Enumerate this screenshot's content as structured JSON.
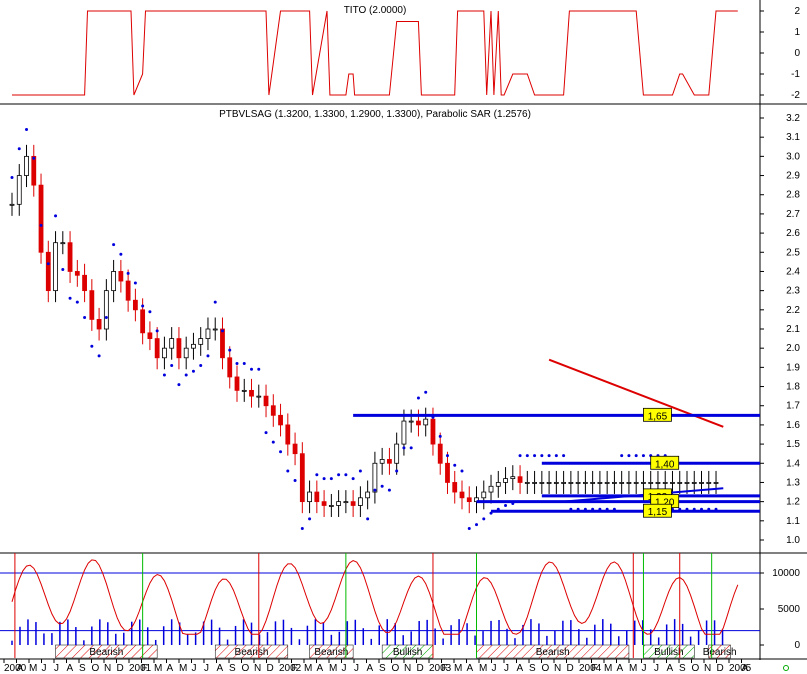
{
  "colors": {
    "red": "#dd0000",
    "blue": "#0000dd",
    "green": "#00bb00",
    "lvlbox": "#ffff00",
    "hatch": "#dd0000"
  },
  "chart_data": [
    {
      "type": "line",
      "title": "TITO (2.0000)",
      "ylim": [
        -2,
        2
      ],
      "ticks": [
        "2",
        "1",
        "0",
        "-1",
        "-2"
      ],
      "x": [
        0,
        0.5,
        0.52,
        0.82,
        0.84,
        0.9,
        0.92,
        0.94,
        1.35,
        1.37,
        1.75,
        1.77,
        1.85,
        1.87,
        1.92,
        2.05,
        2.07,
        2.17,
        2.19,
        2.3,
        2.32,
        2.35,
        2.36,
        2.42,
        2.6,
        2.65,
        2.8,
        2.82,
        3.05,
        3.07,
        3.25,
        3.27,
        3.3,
        3.32,
        3.35,
        3.37,
        3.39,
        3.45,
        3.55,
        3.6,
        3.8,
        3.84,
        4.0,
        4.2,
        4.3,
        4.35,
        4.4,
        4.55,
        4.6,
        4.62,
        4.7,
        4.72,
        4.8,
        4.85,
        5.0
      ],
      "y": [
        -2,
        -2,
        2,
        2,
        -2,
        -1,
        2,
        2,
        2,
        2,
        2,
        -2,
        2,
        2,
        2,
        2,
        -2,
        2,
        -2,
        -2,
        -1,
        -1,
        -2,
        -2,
        -2,
        1.5,
        1.5,
        -2,
        -2,
        2,
        2,
        -2,
        2,
        -2,
        2,
        -2,
        -2,
        -1,
        -1,
        -2,
        -2,
        2,
        2,
        2,
        2,
        -2,
        -2,
        -2,
        -1,
        -1,
        -2,
        -2,
        -2,
        2,
        2
      ]
    },
    {
      "type": "line",
      "title": "PTBVLSAG (1.3200, 1.3300, 1.2900, 1.3300), Parabolic SAR (1.2576)",
      "ylim": [
        1.0,
        3.2
      ],
      "ticks": [
        "3.2",
        "3.1",
        "3.0",
        "2.9",
        "2.8",
        "2.7",
        "2.6",
        "2.5",
        "2.4",
        "2.3",
        "2.2",
        "2.1",
        "2.0",
        "1.9",
        "1.8",
        "1.7",
        "1.6",
        "1.5",
        "1.4",
        "1.3",
        "1.2",
        "1.1",
        "1.0"
      ],
      "x": [
        0,
        0.05,
        0.1,
        0.15,
        0.2,
        0.25,
        0.3,
        0.35,
        0.4,
        0.45,
        0.5,
        0.55,
        0.6,
        0.65,
        0.7,
        0.75,
        0.8,
        0.85,
        0.9,
        0.95,
        1.0,
        1.05,
        1.1,
        1.15,
        1.2,
        1.25,
        1.3,
        1.35,
        1.4,
        1.45,
        1.5,
        1.55,
        1.6,
        1.65,
        1.7,
        1.75,
        1.8,
        1.85,
        1.9,
        1.95,
        2.0,
        2.05,
        2.1,
        2.15,
        2.2,
        2.25,
        2.3,
        2.35,
        2.4,
        2.45,
        2.5,
        2.55,
        2.6,
        2.65,
        2.7,
        2.75,
        2.8,
        2.85,
        2.9,
        2.95,
        3.0,
        3.05,
        3.1,
        3.15,
        3.2,
        3.25,
        3.3,
        3.35,
        3.4,
        3.45,
        3.5,
        3.55,
        3.6,
        3.65,
        3.7,
        3.75,
        3.8,
        3.85,
        3.9,
        3.95,
        4.0,
        4.05,
        4.1,
        4.15,
        4.2,
        4.25,
        4.3,
        4.35,
        4.4,
        4.45,
        4.5,
        4.55,
        4.6,
        4.65,
        4.7,
        4.75,
        4.8,
        4.85
      ],
      "y": [
        2.75,
        2.9,
        3.0,
        2.85,
        2.5,
        2.3,
        2.55,
        2.55,
        2.4,
        2.38,
        2.3,
        2.15,
        2.1,
        2.3,
        2.4,
        2.35,
        2.25,
        2.2,
        2.08,
        2.05,
        1.95,
        2.0,
        2.05,
        1.95,
        2.0,
        2.02,
        2.05,
        2.1,
        2.1,
        1.95,
        1.85,
        1.78,
        1.78,
        1.75,
        1.75,
        1.7,
        1.65,
        1.6,
        1.5,
        1.45,
        1.2,
        1.25,
        1.2,
        1.18,
        1.18,
        1.2,
        1.2,
        1.18,
        1.22,
        1.25,
        1.4,
        1.42,
        1.4,
        1.5,
        1.62,
        1.62,
        1.6,
        1.63,
        1.5,
        1.4,
        1.3,
        1.25,
        1.22,
        1.2,
        1.22,
        1.25,
        1.28,
        1.3,
        1.32,
        1.33,
        1.3,
        1.3,
        1.3,
        1.3,
        1.3,
        1.3,
        1.3,
        1.3,
        1.3,
        1.3,
        1.3,
        1.3,
        1.3,
        1.3,
        1.3,
        1.3,
        1.3,
        1.3,
        1.3,
        1.3,
        1.3,
        1.3,
        1.3,
        1.3,
        1.3,
        1.3,
        1.3,
        1.3
      ],
      "levels": [
        "1,65",
        "1,40",
        "1,23",
        "1,20",
        "1,15"
      ]
    },
    {
      "type": "area",
      "ticks": [
        "10000",
        "5000",
        "0"
      ],
      "regimes": [
        "Bearish",
        "Bearish",
        "Bearish",
        "Bullish",
        "Bearish",
        "Bullish",
        "Bearish"
      ]
    }
  ],
  "xaxis": {
    "labels": [
      "2000",
      "A",
      "M",
      "J",
      "J",
      "A",
      "S",
      "O",
      "N",
      "D",
      "2001",
      "F",
      "M",
      "A",
      "M",
      "J",
      "J",
      "A",
      "S",
      "O",
      "N",
      "D",
      "2002",
      "F",
      "M",
      "A",
      "M",
      "J",
      "J",
      "A",
      "S",
      "O",
      "N",
      "D",
      "2003",
      "F",
      "M",
      "A",
      "M",
      "J",
      "J",
      "A",
      "S",
      "O",
      "N",
      "D",
      "2004",
      "F",
      "M",
      "A",
      "M",
      "J",
      "J",
      "A",
      "S",
      "O",
      "N",
      "D",
      "2005",
      "A"
    ]
  }
}
